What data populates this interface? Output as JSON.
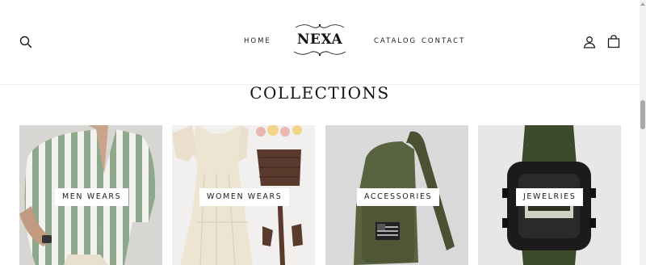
{
  "brand": {
    "logo_text": "NEXA"
  },
  "nav": [
    {
      "label": "HOME"
    },
    {
      "label": "CATALOG"
    },
    {
      "label": "CONTACT"
    }
  ],
  "header_icons": [
    "search-icon",
    "account-icon",
    "cart-icon"
  ],
  "collections": {
    "title": "COLLECTIONS",
    "items": [
      {
        "label": "MEN WEARS"
      },
      {
        "label": "WOMEN WEARS"
      },
      {
        "label": "ACCESSORIES"
      },
      {
        "label": "JEWELRIES"
      }
    ]
  },
  "colors": {
    "text": "#1c1d1d",
    "background": "#ffffff",
    "card_background": "#e6e6e6"
  }
}
